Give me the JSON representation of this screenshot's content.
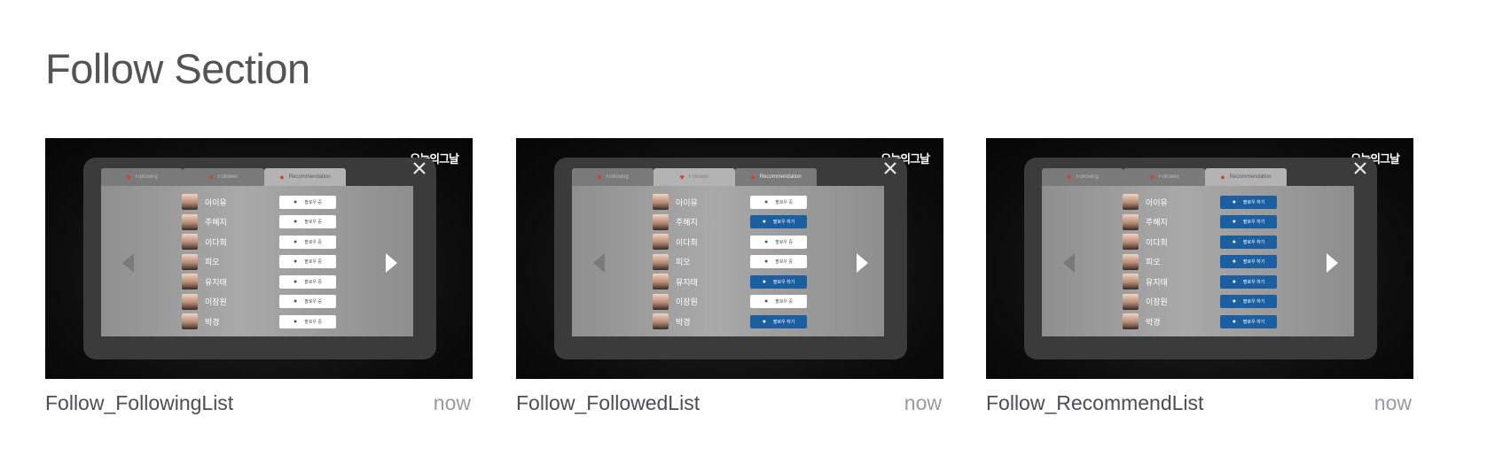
{
  "page": {
    "title": "Follow Section"
  },
  "app": {
    "logo": "오늘의그날",
    "tabs": [
      "Following",
      "Follower",
      "Recommendation"
    ],
    "users": [
      "아이유",
      "주혜지",
      "이다희",
      "피오",
      "유지태",
      "이장원",
      "박경"
    ],
    "button_labels": {
      "following": "팔로우 중",
      "follow": "팔로우 하기"
    }
  },
  "cards": [
    {
      "name": "Follow_FollowingList",
      "time": "now",
      "active_tab": 2,
      "buttons": [
        "following",
        "following",
        "following",
        "following",
        "following",
        "following",
        "following"
      ]
    },
    {
      "name": "Follow_FollowedList",
      "time": "now",
      "active_tab": 1,
      "buttons": [
        "following",
        "follow",
        "following",
        "following",
        "follow",
        "following",
        "follow"
      ]
    },
    {
      "name": "Follow_RecommendList",
      "time": "now",
      "active_tab": 2,
      "buttons": [
        "follow",
        "follow",
        "follow",
        "follow",
        "follow",
        "follow",
        "follow"
      ]
    }
  ]
}
